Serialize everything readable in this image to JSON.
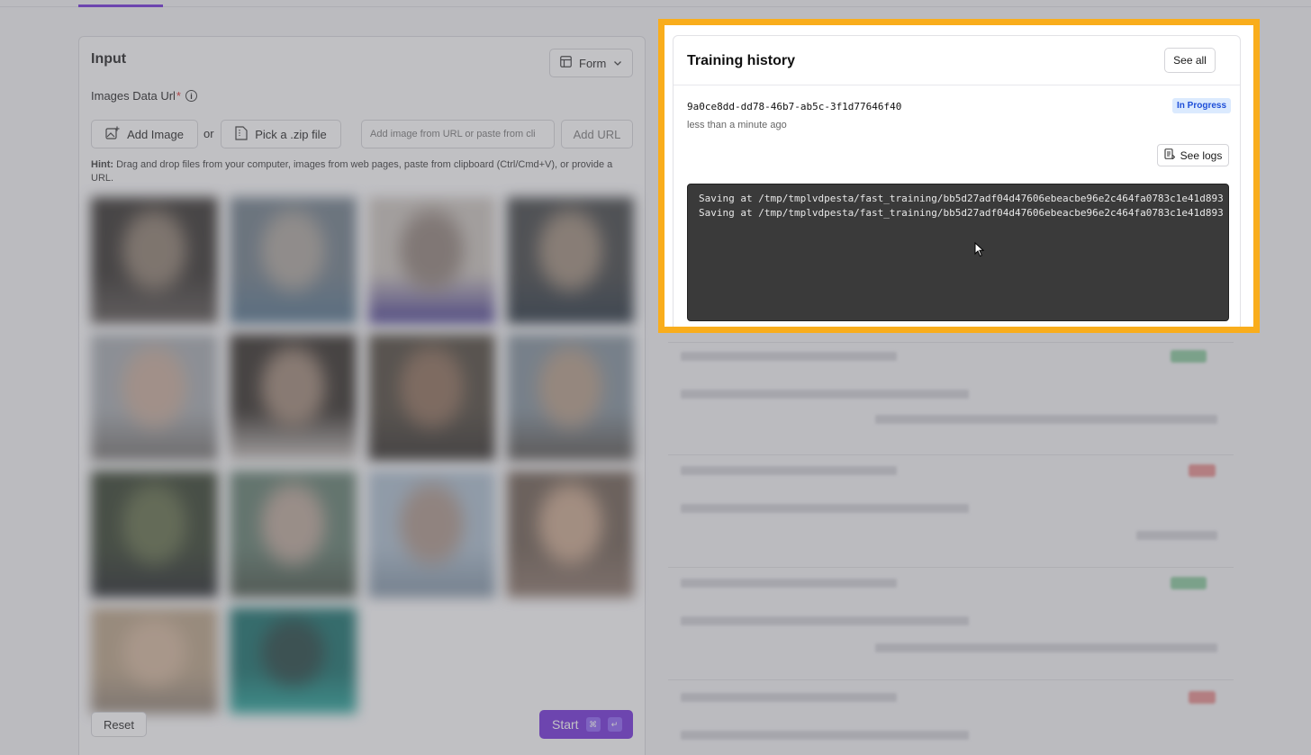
{
  "input_panel": {
    "title": "Input",
    "view_mode": "Form",
    "images_label": "Images Data Url",
    "required_marker": "*",
    "add_image_label": "Add Image",
    "or_text": "or",
    "pick_zip_label": "Pick a .zip file",
    "url_placeholder": "Add image from URL or paste from cli",
    "add_url_label": "Add URL",
    "hint_prefix": "Hint:",
    "hint_text": " Drag and drop files from your computer, images from web pages, paste from clipboard (Ctrl/Cmd+V), or provide a URL.",
    "thumbnails": [
      {
        "colors": [
          "#2e2a26",
          "#8a7a6a",
          "#5a5450"
        ]
      },
      {
        "colors": [
          "#6b7a86",
          "#a9a39b",
          "#4c6f8a"
        ]
      },
      {
        "colors": [
          "#c9c2bb",
          "#8e7f76",
          "#3b2f8a"
        ]
      },
      {
        "colors": [
          "#3c3f40",
          "#9b8977",
          "#1f2d3a"
        ]
      },
      {
        "colors": [
          "#a3a8ad",
          "#c6aa98",
          "#6d6a66"
        ]
      },
      {
        "colors": [
          "#2c2620",
          "#9c8472",
          "#c9c4bf"
        ]
      },
      {
        "colors": [
          "#4a4236",
          "#8a6a54",
          "#2a2622"
        ]
      },
      {
        "colors": [
          "#7f8e99",
          "#b29a85",
          "#4f4a44"
        ]
      },
      {
        "colors": [
          "#2e3a26",
          "#5e6a44",
          "#1b1e22"
        ]
      },
      {
        "colors": [
          "#5d7a6a",
          "#b9a597",
          "#3f4d40"
        ]
      },
      {
        "colors": [
          "#a9bccd",
          "#a99387",
          "#7a8ea0"
        ]
      },
      {
        "colors": [
          "#6b5a4d",
          "#c9a58a",
          "#8a7366"
        ]
      },
      {
        "colors": [
          "#b7a083",
          "#d3b59a",
          "#8a7c6e"
        ]
      },
      {
        "colors": [
          "#0e6b66",
          "#1a3f3c",
          "#20a59a"
        ]
      }
    ],
    "reset_label": "Reset",
    "start_label": "Start",
    "start_kbd": [
      "⌘",
      "↵"
    ]
  },
  "training_history": {
    "title": "Training history",
    "see_all_label": "See all",
    "run": {
      "id": "9a0ce8dd-dd78-46b7-ab5c-3f1d77646f40",
      "time": "less than a minute ago",
      "status": "In Progress",
      "see_logs_label": "See logs",
      "logs": [
        "Saving at /tmp/tmplvdpesta/fast_training/bb5d27adf04d47606ebeacbe96e2c464fa0783c1e41d893",
        "Saving at /tmp/tmplvdpesta/fast_training/bb5d27adf04d47606ebeacbe96e2c464fa0783c1e41d893"
      ]
    }
  },
  "colors": {
    "accent": "#6d28d9",
    "highlight": "#f9ad1c",
    "status_in_progress": "#1d4ed8",
    "log_background": "#3a3a3a"
  },
  "icons": [
    "info-icon",
    "form-layout-icon",
    "chevron-down-icon",
    "add-image-icon",
    "file-zip-icon",
    "logs-icon",
    "mouse-cursor-icon"
  ]
}
